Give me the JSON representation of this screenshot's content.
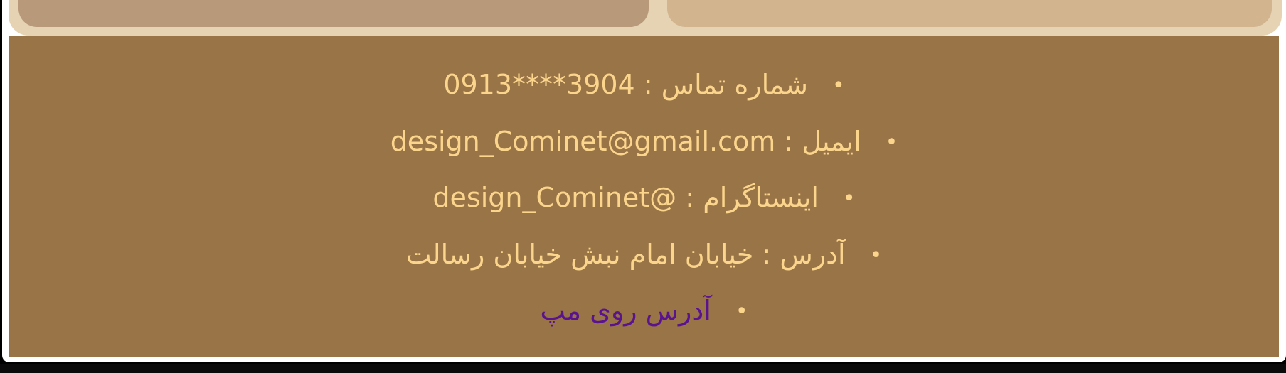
{
  "footer": {
    "contacts": [
      {
        "label": "شماره تماس",
        "separator": ":",
        "value": "0913****3904"
      },
      {
        "label": "ایمیل",
        "separator": ":",
        "value": "design_Cominet@gmail.com"
      },
      {
        "label": "اینستاگرام",
        "separator": ":",
        "value": "design_Cominet@"
      },
      {
        "label": "آدرس",
        "separator": ":",
        "value": "خیابان امام نبش خیابان رسالت"
      }
    ],
    "map_link_label": "آدرس روی مپ",
    "bullet": "•"
  },
  "colors": {
    "footer_background": "#997447",
    "text": "#fbd58c",
    "link": "#5a138f",
    "card_frame": "#e5d3b3",
    "card_left": "#b8997a",
    "card_right": "#d2b48f"
  }
}
